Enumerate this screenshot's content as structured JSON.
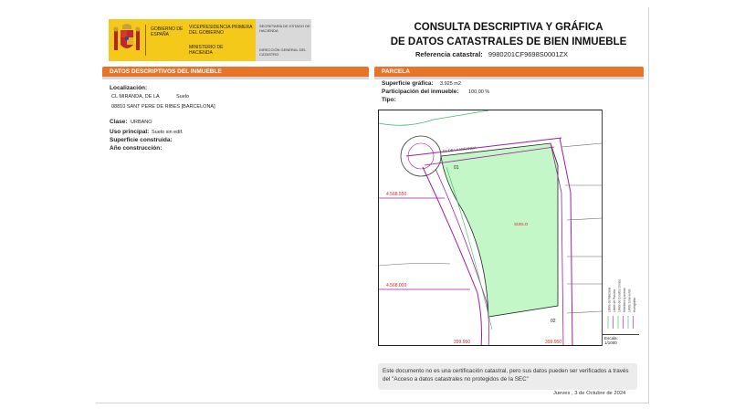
{
  "header": {
    "gobierno_label": "GOBIERNO DE ESPAÑA",
    "vicepresidencia_label": "VICEPRESIDENCIA PRIMERA DEL GOBIERNO",
    "ministerio_label": "MINISTERIO DE HACIENDA",
    "secretaria_label": "SECRETARÍA DE ESTADO DE HACIENDA",
    "direccion_label": "DIRECCIÓN GENERAL DEL CATASTRO",
    "title_line1": "CONSULTA DESCRIPTIVA Y GRÁFICA",
    "title_line2": "DE DATOS CATASTRALES DE BIEN INMUEBLE",
    "ref_label": "Referencia catastral:",
    "ref_value": "9980201CF9698S0001ZX"
  },
  "descriptivos": {
    "section_title": "DATOS DESCRIPTIVOS DEL INMUEBLE",
    "localizacion_label": "Localización:",
    "address_line1": "CL MIRANDA, DE LA",
    "address_use": "Suelo",
    "address_line2": "08810 SANT PERE DE RIBES [BARCELONA]",
    "clase_label": "Clase:",
    "clase_value": "URBANO",
    "uso_label": "Uso principal:",
    "uso_value": "Suelo sin edif.",
    "superficie_label": "Superficie construida:",
    "anio_label": "Año construcción:"
  },
  "parcela": {
    "section_title": "PARCELA",
    "superficie_grafica_label": "Superficie gráfica:",
    "superficie_grafica_value": "3.925 m2",
    "participacion_label": "Participación del inmueble:",
    "participacion_value": "100,00 %",
    "tipo_label": "Tipo:"
  },
  "map": {
    "coord_y1": "4.568.550",
    "coord_y2": "4.568.000",
    "coord_x1": "399.950",
    "coord_x2": "399.950",
    "parcel_label": "01",
    "corner_label": "02",
    "center_label": "SUELO",
    "street_label": "CL DE LA MIRANDA",
    "scale_label": "Escala:",
    "scale_value": "1/1000",
    "legend_items": [
      "Límite de Manzana",
      "Límite de Parcela",
      "Límite de Construcciones",
      "Mobiliario y aceras",
      "Límite zona verde",
      "Hidrografía"
    ],
    "parcel_color": "#c3f7c8",
    "road_color": "#a01ea0",
    "green_line_color": "#3cb468"
  },
  "footer": {
    "notice_text": "Este documento no es una certificación catastral, pero sus datos pueden ser verificados a través del \"Acceso a datos catastrales no protegidos de la SEC\"",
    "date_text": "Jueves , 3 de Octubre de 2024"
  }
}
